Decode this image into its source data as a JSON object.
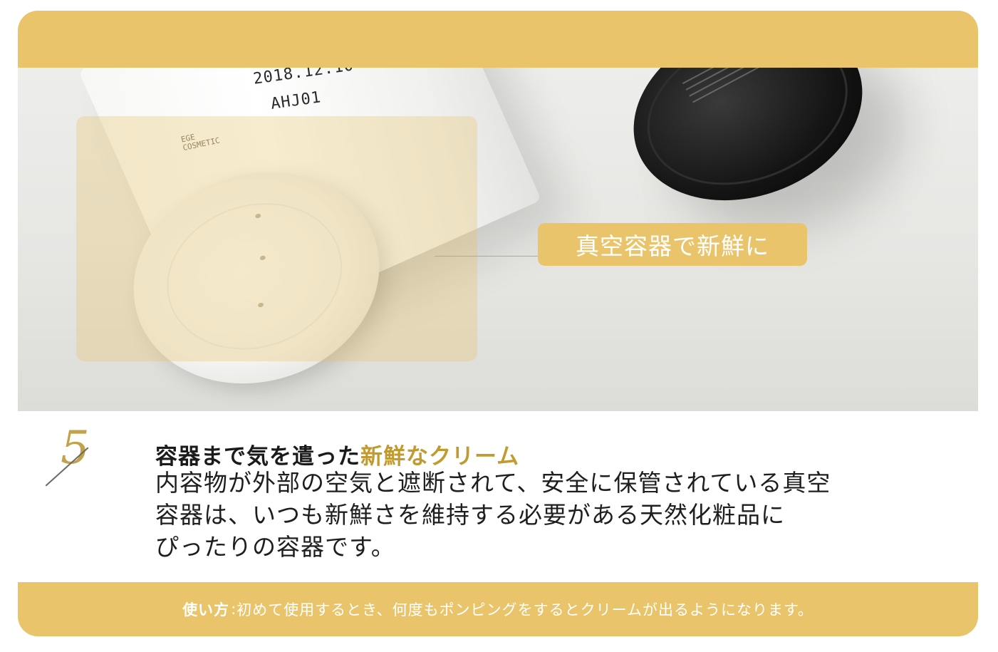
{
  "photo": {
    "print_date": "2018.12.10",
    "print_code": "AHJ01",
    "brand_mark_line1": "EGE",
    "brand_mark_line2": "COSMETIC",
    "label": "真空容器で新鮮に"
  },
  "feature": {
    "number": "5",
    "heading_plain": "容器まで気を遣った",
    "heading_accent": "新鮮なクリーム",
    "body_line1": "内容物が外部の空気と遮断されて、安全に保管されている真空",
    "body_line2": "容器は、いつも新鮮さを維持する必要がある天然化粧品に",
    "body_line3": "ぴったりの容器です。"
  },
  "footer": {
    "label": "使い方",
    "separator": " : ",
    "text": "初めて使用するとき、何度もポンピングをするとクリームが出るようになります。"
  },
  "colors": {
    "accent": "#e9c46a",
    "accent_text": "#c29a2e"
  }
}
